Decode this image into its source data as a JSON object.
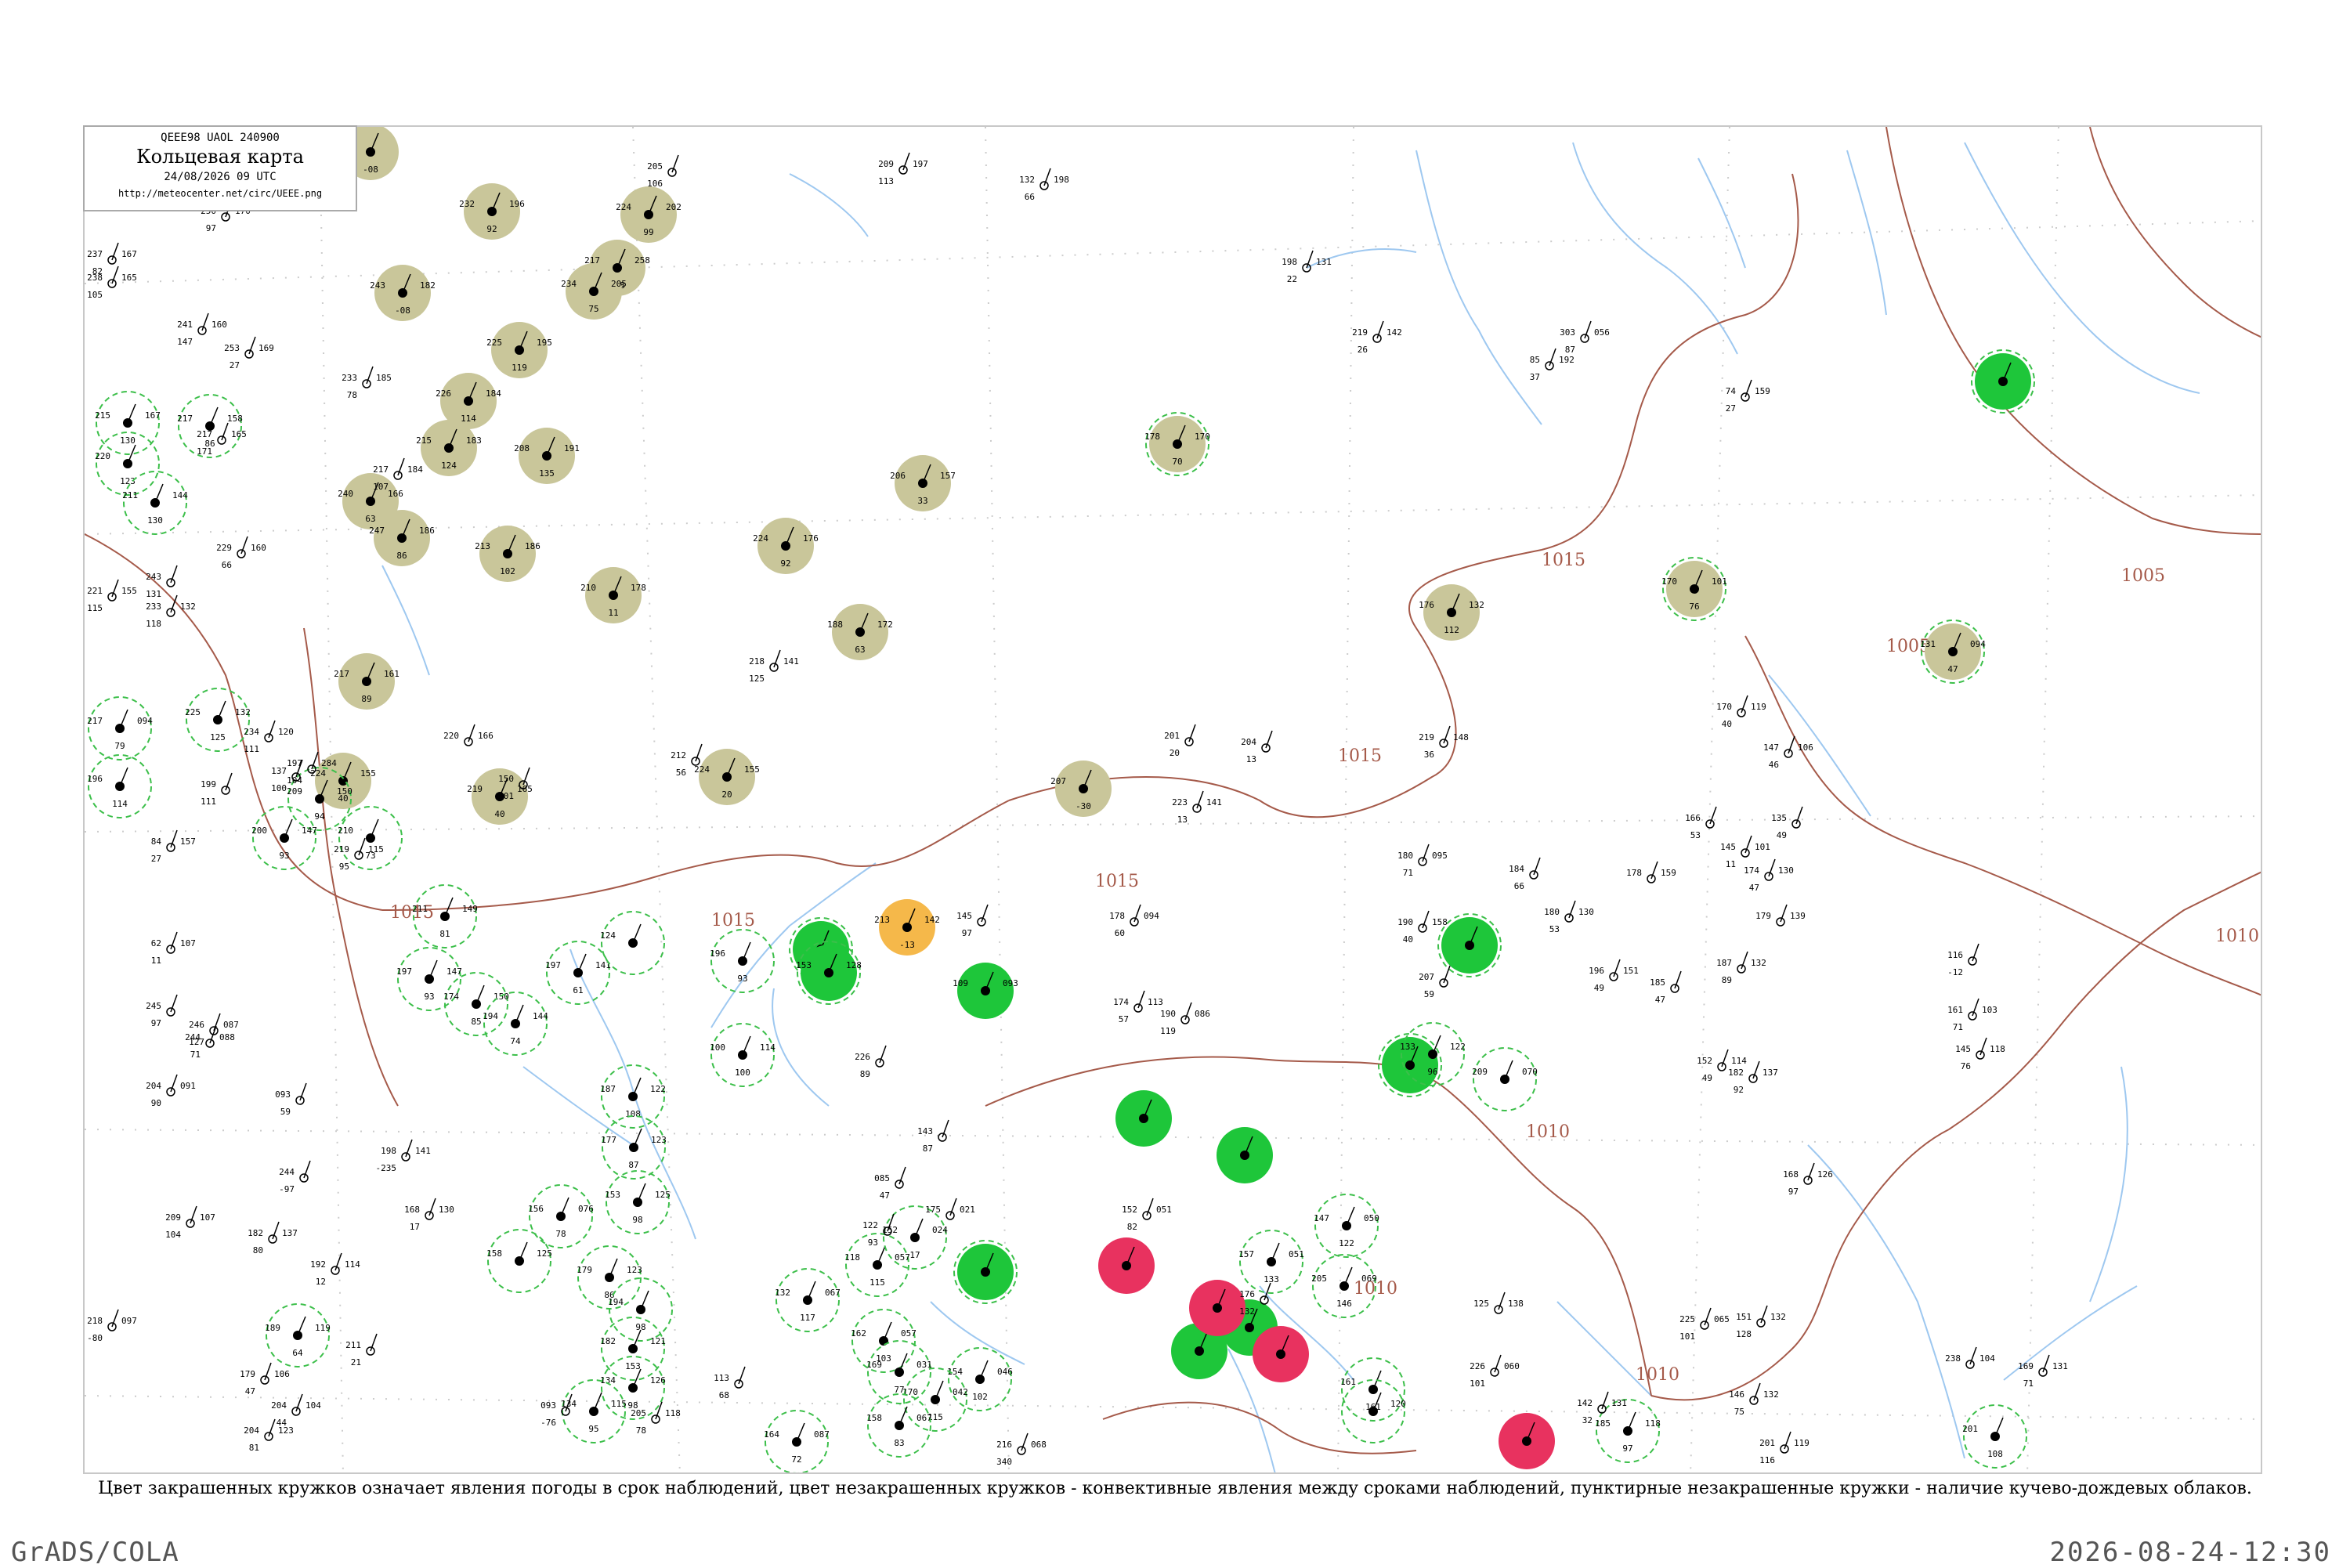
{
  "header": {
    "code": "QEEE98  UAOL  240900",
    "title": "Кольцевая карта",
    "datetime": "24/08/2026 09 UTC",
    "url": "http://meteocenter.net/circ/UEEE.png"
  },
  "caption": "Цвет закрашенных кружков означает явления погоды в срок наблюдений, цвет незакрашенных кружков - конвективные явления между сроками наблюдений, пунктирные незакрашенные кружки - наличие кучево-дождевых облаков.",
  "footer": {
    "left": "GrADS/COLA",
    "right": "2026-08-24-12:30"
  },
  "colors": {
    "olive": "#c9c69a",
    "green": "#1ec63a",
    "red": "#e8325f",
    "orange": "#f5b84a",
    "isobar": "#a55a4a",
    "river": "#9ec8f0",
    "dashed_green": "#3cbf4a"
  },
  "isobar_labels": [
    "1015",
    "1015",
    "1015",
    "1015",
    "1015",
    "1010",
    "1010",
    "1010",
    "1005",
    "1005",
    "1010"
  ],
  "stations": [
    {
      "fill": "olive",
      "dashed": false,
      "v1": "180",
      "v2": "",
      "p": "-08"
    },
    {
      "fill": "olive",
      "dashed": false,
      "v1": "232",
      "v2": "196",
      "p": "92"
    },
    {
      "fill": "olive",
      "dashed": false,
      "v1": "224",
      "v2": "202",
      "p": "99"
    },
    {
      "fill": "olive",
      "dashed": false,
      "v1": "217",
      "v2": "258",
      "p": "108"
    },
    {
      "fill": "olive",
      "dashed": false,
      "v1": "234",
      "v2": "205",
      "p": "75"
    },
    {
      "fill": "olive",
      "dashed": false,
      "v1": "243",
      "v2": "182",
      "p": "-08"
    },
    {
      "fill": "olive",
      "dashed": false,
      "v1": "225",
      "v2": "195",
      "p": "119"
    },
    {
      "fill": "olive",
      "dashed": false,
      "v1": "226",
      "v2": "184",
      "p": "114"
    },
    {
      "fill": "olive",
      "dashed": false,
      "v1": "215",
      "v2": "183",
      "p": "124"
    },
    {
      "fill": "olive",
      "dashed": false,
      "v1": "208",
      "v2": "191",
      "p": "135"
    },
    {
      "fill": "olive",
      "dashed": false,
      "v1": "240",
      "v2": "166",
      "p": "63"
    },
    {
      "fill": "olive",
      "dashed": false,
      "v1": "247",
      "v2": "186",
      "p": "86"
    },
    {
      "fill": "olive",
      "dashed": false,
      "v1": "213",
      "v2": "186",
      "p": "102"
    },
    {
      "fill": "olive",
      "dashed": false,
      "v1": "210",
      "v2": "178",
      "p": "11"
    },
    {
      "fill": "olive",
      "dashed": false,
      "v1": "217",
      "v2": "161",
      "p": "89"
    },
    {
      "fill": "olive",
      "dashed": false,
      "v1": "224",
      "v2": "176",
      "p": "92"
    },
    {
      "fill": "olive",
      "dashed": false,
      "v1": "188",
      "v2": "172",
      "p": "63"
    },
    {
      "fill": "olive",
      "dashed": false,
      "v1": "206",
      "v2": "157",
      "p": "33"
    },
    {
      "fill": "olive",
      "dashed": true,
      "v1": "178",
      "v2": "170",
      "p": "70"
    },
    {
      "fill": "olive",
      "dashed": false,
      "v1": "176",
      "v2": "132",
      "p": "112"
    },
    {
      "fill": "olive",
      "dashed": true,
      "v1": "170",
      "v2": "101",
      "p": "76"
    },
    {
      "fill": "olive",
      "dashed": true,
      "v1": "131",
      "v2": "094",
      "p": "47"
    },
    {
      "fill": "olive",
      "dashed": false,
      "v1": "224",
      "v2": "155",
      "p": "20"
    },
    {
      "fill": "olive",
      "dashed": false,
      "v1": "219",
      "v2": "165",
      "p": "40"
    },
    {
      "fill": "olive",
      "dashed": false,
      "v1": "224",
      "v2": "155",
      "p": "40"
    },
    {
      "fill": "olive",
      "dashed": false,
      "v1": "207",
      "v2": "",
      "p": "-30"
    },
    {
      "fill": "orange",
      "dashed": false,
      "v1": "213",
      "v2": "142",
      "p": "-13"
    },
    {
      "fill": "green",
      "dashed": true,
      "v1": "",
      "v2": "",
      "p": ""
    },
    {
      "fill": "green",
      "dashed": true,
      "v1": "153",
      "v2": "128",
      "p": ""
    },
    {
      "fill": "green",
      "dashed": true,
      "v1": "",
      "v2": "",
      "p": ""
    },
    {
      "fill": "green",
      "dashed": false,
      "v1": "109",
      "v2": "093",
      "p": ""
    },
    {
      "fill": "green",
      "dashed": true,
      "v1": "",
      "v2": "",
      "p": ""
    },
    {
      "fill": "green",
      "dashed": false,
      "v1": "",
      "v2": "",
      "p": ""
    },
    {
      "fill": "green",
      "dashed": false,
      "v1": "",
      "v2": "",
      "p": ""
    },
    {
      "fill": "green",
      "dashed": true,
      "v1": "",
      "v2": "",
      "p": ""
    },
    {
      "fill": "green",
      "dashed": false,
      "v1": "",
      "v2": "",
      "p": ""
    },
    {
      "fill": "green",
      "dashed": false,
      "v1": "",
      "v2": "",
      "p": ""
    },
    {
      "fill": "green",
      "dashed": true,
      "v1": "",
      "v2": "",
      "p": ""
    },
    {
      "fill": "red",
      "dashed": false,
      "v1": "",
      "v2": "",
      "p": ""
    },
    {
      "fill": "red",
      "dashed": false,
      "v1": "",
      "v2": "",
      "p": ""
    },
    {
      "fill": "red",
      "dashed": false,
      "v1": "",
      "v2": "",
      "p": ""
    },
    {
      "fill": "red",
      "dashed": false,
      "v1": "",
      "v2": "",
      "p": ""
    },
    {
      "fill": "none",
      "dashed": true,
      "v1": "215",
      "v2": "167",
      "p": "130"
    },
    {
      "fill": "none",
      "dashed": true,
      "v1": "220",
      "v2": "",
      "p": "123"
    },
    {
      "fill": "none",
      "dashed": true,
      "v1": "217",
      "v2": "158",
      "p": "86"
    },
    {
      "fill": "none",
      "dashed": true,
      "v1": "211",
      "v2": "144",
      "p": "130"
    },
    {
      "fill": "none",
      "dashed": true,
      "v1": "217",
      "v2": "094",
      "p": "79"
    },
    {
      "fill": "none",
      "dashed": true,
      "v1": "196",
      "v2": "",
      "p": "114"
    },
    {
      "fill": "none",
      "dashed": true,
      "v1": "225",
      "v2": "132",
      "p": "125"
    },
    {
      "fill": "none",
      "dashed": true,
      "v1": "209",
      "v2": "150",
      "p": "94"
    },
    {
      "fill": "none",
      "dashed": true,
      "v1": "200",
      "v2": "147",
      "p": "93"
    },
    {
      "fill": "none",
      "dashed": true,
      "v1": "210",
      "v2": "",
      "p": "73"
    },
    {
      "fill": "none",
      "dashed": true,
      "v1": "211",
      "v2": "149",
      "p": "81"
    },
    {
      "fill": "none",
      "dashed": true,
      "v1": "197",
      "v2": "147",
      "p": "93"
    },
    {
      "fill": "none",
      "dashed": true,
      "v1": "174",
      "v2": "150",
      "p": "85"
    },
    {
      "fill": "none",
      "dashed": true,
      "v1": "197",
      "v2": "141",
      "p": "61"
    },
    {
      "fill": "none",
      "dashed": true,
      "v1": "194",
      "v2": "144",
      "p": "74"
    },
    {
      "fill": "none",
      "dashed": true,
      "v1": "124",
      "v2": "",
      "p": ""
    },
    {
      "fill": "none",
      "dashed": true,
      "v1": "196",
      "v2": "",
      "p": "93"
    },
    {
      "fill": "none",
      "dashed": true,
      "v1": "100",
      "v2": "114",
      "p": "100"
    },
    {
      "fill": "none",
      "dashed": true,
      "v1": "187",
      "v2": "122",
      "p": "108"
    },
    {
      "fill": "none",
      "dashed": true,
      "v1": "177",
      "v2": "123",
      "p": "87"
    },
    {
      "fill": "none",
      "dashed": true,
      "v1": "153",
      "v2": "125",
      "p": "98"
    },
    {
      "fill": "none",
      "dashed": true,
      "v1": "156",
      "v2": "076",
      "p": "78"
    },
    {
      "fill": "none",
      "dashed": true,
      "v1": "158",
      "v2": "125",
      "p": ""
    },
    {
      "fill": "none",
      "dashed": true,
      "v1": "179",
      "v2": "123",
      "p": "86"
    },
    {
      "fill": "none",
      "dashed": true,
      "v1": "182",
      "v2": "121",
      "p": "153"
    },
    {
      "fill": "none",
      "dashed": true,
      "v1": "194",
      "v2": "",
      "p": "98"
    },
    {
      "fill": "none",
      "dashed": true,
      "v1": "134",
      "v2": "126",
      "p": "98"
    },
    {
      "fill": "none",
      "dashed": true,
      "v1": "134",
      "v2": "115",
      "p": "95"
    },
    {
      "fill": "none",
      "dashed": true,
      "v1": "189",
      "v2": "119",
      "p": "64"
    },
    {
      "fill": "none",
      "dashed": true,
      "v1": "132",
      "v2": "067",
      "p": "117"
    },
    {
      "fill": "none",
      "dashed": true,
      "v1": "118",
      "v2": "057",
      "p": "115"
    },
    {
      "fill": "none",
      "dashed": true,
      "v1": "152",
      "v2": "024",
      "p": "17"
    },
    {
      "fill": "none",
      "dashed": true,
      "v1": "162",
      "v2": "057",
      "p": "103"
    },
    {
      "fill": "none",
      "dashed": true,
      "v1": "169",
      "v2": "031",
      "p": "77"
    },
    {
      "fill": "none",
      "dashed": true,
      "v1": "154",
      "v2": "046",
      "p": "102"
    },
    {
      "fill": "none",
      "dashed": true,
      "v1": "170",
      "v2": "042",
      "p": "115"
    },
    {
      "fill": "none",
      "dashed": true,
      "v1": "158",
      "v2": "067",
      "p": "83"
    },
    {
      "fill": "none",
      "dashed": true,
      "v1": "164",
      "v2": "087",
      "p": "72"
    },
    {
      "fill": "none",
      "dashed": true,
      "v1": "147",
      "v2": "050",
      "p": "122"
    },
    {
      "fill": "none",
      "dashed": true,
      "v1": "157",
      "v2": "051",
      "p": "133"
    },
    {
      "fill": "none",
      "dashed": true,
      "v1": "205",
      "v2": "069",
      "p": "146"
    },
    {
      "fill": "none",
      "dashed": true,
      "v1": "161",
      "v2": "",
      "p": "161"
    },
    {
      "fill": "none",
      "dashed": true,
      "v1": "",
      "v2": "120",
      "p": ""
    },
    {
      "fill": "none",
      "dashed": true,
      "v1": "133",
      "v2": "122",
      "p": "96"
    },
    {
      "fill": "none",
      "dashed": true,
      "v1": "209",
      "v2": "070",
      "p": ""
    },
    {
      "fill": "none",
      "dashed": true,
      "v1": "185",
      "v2": "118",
      "p": "97"
    },
    {
      "fill": "none",
      "dashed": true,
      "v1": "201",
      "v2": "",
      "p": "108"
    }
  ],
  "plain_stations": [
    {
      "v1": "205",
      "v2": "",
      "p": "106"
    },
    {
      "v1": "209",
      "v2": "197",
      "p": "113"
    },
    {
      "v1": "132",
      "v2": "198",
      "p": "66"
    },
    {
      "v1": "250",
      "v2": "170",
      "p": "97"
    },
    {
      "v1": "237",
      "v2": "167",
      "p": "82"
    },
    {
      "v1": "238",
      "v2": "165",
      "p": "105"
    },
    {
      "v1": "241",
      "v2": "160",
      "p": "147"
    },
    {
      "v1": "253",
      "v2": "169",
      "p": "27"
    },
    {
      "v1": "233",
      "v2": "185",
      "p": "78"
    },
    {
      "v1": "217",
      "v2": "165",
      "p": "171"
    },
    {
      "v1": "217",
      "v2": "184",
      "p": "107"
    },
    {
      "v1": "229",
      "v2": "160",
      "p": "66"
    },
    {
      "v1": "221",
      "v2": "155",
      "p": "115"
    },
    {
      "v1": "243",
      "v2": "",
      "p": "131"
    },
    {
      "v1": "233",
      "v2": "132",
      "p": "118"
    },
    {
      "v1": "234",
      "v2": "120",
      "p": "111"
    },
    {
      "v1": "218",
      "v2": "141",
      "p": "125"
    },
    {
      "v1": "197",
      "v2": "284",
      "p": "104"
    },
    {
      "v1": "220",
      "v2": "166",
      "p": ""
    },
    {
      "v1": "199",
      "v2": "",
      "p": "111"
    },
    {
      "v1": "137",
      "v2": "",
      "p": "100"
    },
    {
      "v1": "219",
      "v2": "115",
      "p": "95"
    },
    {
      "v1": "150",
      "v2": "",
      "p": "-01"
    },
    {
      "v1": "212",
      "v2": "",
      "p": "56"
    },
    {
      "v1": "201",
      "v2": "",
      "p": "20"
    },
    {
      "v1": "204",
      "v2": "",
      "p": "13"
    },
    {
      "v1": "219",
      "v2": "148",
      "p": "36"
    },
    {
      "v1": "223",
      "v2": "141",
      "p": "13"
    },
    {
      "v1": "198",
      "v2": "131",
      "p": "22"
    },
    {
      "v1": "219",
      "v2": "142",
      "p": "26"
    },
    {
      "v1": "85",
      "v2": "192",
      "p": "37"
    },
    {
      "v1": "303",
      "v2": "056",
      "p": "87"
    },
    {
      "v1": "74",
      "v2": "159",
      "p": "27"
    },
    {
      "v1": "84",
      "v2": "157",
      "p": "27"
    },
    {
      "v1": "62",
      "v2": "107",
      "p": "11"
    },
    {
      "v1": "245",
      "v2": "",
      "p": "97"
    },
    {
      "v1": "246",
      "v2": "087",
      "p": "127"
    },
    {
      "v1": "244",
      "v2": "088",
      "p": "71"
    },
    {
      "v1": "204",
      "v2": "091",
      "p": "90"
    },
    {
      "v1": "093",
      "v2": "",
      "p": "59"
    },
    {
      "v1": "244",
      "v2": "",
      "p": "-97"
    },
    {
      "v1": "198",
      "v2": "141",
      "p": "-235"
    },
    {
      "v1": "168",
      "v2": "130",
      "p": "17"
    },
    {
      "v1": "209",
      "v2": "107",
      "p": "104"
    },
    {
      "v1": "182",
      "v2": "137",
      "p": "80"
    },
    {
      "v1": "192",
      "v2": "114",
      "p": "12"
    },
    {
      "v1": "218",
      "v2": "097",
      "p": "-80"
    },
    {
      "v1": "211",
      "v2": "",
      "p": "21"
    },
    {
      "v1": "179",
      "v2": "106",
      "p": "47"
    },
    {
      "v1": "204",
      "v2": "104",
      "p": "44"
    },
    {
      "v1": "204",
      "v2": "123",
      "p": "81"
    },
    {
      "v1": "093",
      "v2": "",
      "p": "-76"
    },
    {
      "v1": "205",
      "v2": "118",
      "p": "78"
    },
    {
      "v1": "113",
      "v2": "",
      "p": "68"
    },
    {
      "v1": "122",
      "v2": "",
      "p": "93"
    },
    {
      "v1": "143",
      "v2": "",
      "p": "87"
    },
    {
      "v1": "085",
      "v2": "",
      "p": "47"
    },
    {
      "v1": "175",
      "v2": "021",
      "p": ""
    },
    {
      "v1": "145",
      "v2": "",
      "p": "97"
    },
    {
      "v1": "226",
      "v2": "",
      "p": "89"
    },
    {
      "v1": "174",
      "v2": "113",
      "p": "57"
    },
    {
      "v1": "190",
      "v2": "086",
      "p": "119"
    },
    {
      "v1": "178",
      "v2": "094",
      "p": "60"
    },
    {
      "v1": "180",
      "v2": "095",
      "p": "71"
    },
    {
      "v1": "190",
      "v2": "158",
      "p": "40"
    },
    {
      "v1": "207",
      "v2": "",
      "p": "59"
    },
    {
      "v1": "184",
      "v2": "",
      "p": "66"
    },
    {
      "v1": "180",
      "v2": "130",
      "p": "53"
    },
    {
      "v1": "196",
      "v2": "151",
      "p": "49"
    },
    {
      "v1": "178",
      "v2": "159",
      "p": ""
    },
    {
      "v1": "187",
      "v2": "132",
      "p": "89"
    },
    {
      "v1": "185",
      "v2": "",
      "p": "47"
    },
    {
      "v1": "174",
      "v2": "130",
      "p": "47"
    },
    {
      "v1": "179",
      "v2": "139",
      "p": ""
    },
    {
      "v1": "170",
      "v2": "119",
      "p": "40"
    },
    {
      "v1": "147",
      "v2": "106",
      "p": "46"
    },
    {
      "v1": "135",
      "v2": "",
      "p": "49"
    },
    {
      "v1": "145",
      "v2": "101",
      "p": "11"
    },
    {
      "v1": "166",
      "v2": "",
      "p": "53"
    },
    {
      "v1": "116",
      "v2": "",
      "p": "-12"
    },
    {
      "v1": "161",
      "v2": "103",
      "p": "71"
    },
    {
      "v1": "145",
      "v2": "118",
      "p": "76"
    },
    {
      "v1": "152",
      "v2": "114",
      "p": "49"
    },
    {
      "v1": "182",
      "v2": "137",
      "p": "92"
    },
    {
      "v1": "168",
      "v2": "126",
      "p": "97"
    },
    {
      "v1": "125",
      "v2": "138",
      "p": ""
    },
    {
      "v1": "226",
      "v2": "060",
      "p": "101"
    },
    {
      "v1": "225",
      "v2": "065",
      "p": "101"
    },
    {
      "v1": "151",
      "v2": "132",
      "p": "128"
    },
    {
      "v1": "146",
      "v2": "132",
      "p": "75"
    },
    {
      "v1": "201",
      "v2": "119",
      "p": "116"
    },
    {
      "v1": "238",
      "v2": "104",
      "p": ""
    },
    {
      "v1": "169",
      "v2": "131",
      "p": "71"
    },
    {
      "v1": "142",
      "v2": "131",
      "p": "32"
    },
    {
      "v1": "216",
      "v2": "068",
      "p": "340"
    },
    {
      "v1": "152",
      "v2": "051",
      "p": "82"
    },
    {
      "v1": "176",
      "v2": "",
      "p": "132"
    },
    {
      "v1": "213",
      "v2": "023",
      "p": ""
    }
  ]
}
